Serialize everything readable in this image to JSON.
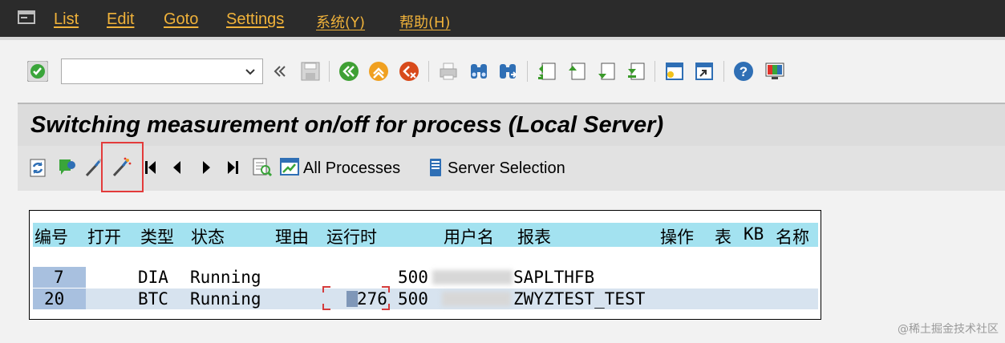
{
  "menu": {
    "items": [
      "List",
      "Edit",
      "Goto",
      "Settings",
      "系统(Y)",
      "帮助(H)"
    ]
  },
  "command_field": {
    "value": ""
  },
  "title": "Switching measurement on/off for process (Local Server)",
  "app_toolbar": {
    "all_processes_label": "All Processes",
    "server_selection_label": "Server Selection"
  },
  "list": {
    "headers": [
      "编号",
      "打开",
      "类型",
      "状态",
      "理由",
      "运行时",
      "用户名",
      "报表",
      "操作",
      "表",
      "KB",
      "名称"
    ],
    "rows": [
      {
        "no": "7",
        "type": "DIA",
        "status": "Running",
        "runtime": "",
        "client": "500",
        "report": "SAPLTHFB"
      },
      {
        "no": "20",
        "type": "BTC",
        "status": "Running",
        "runtime": "276",
        "client": "500",
        "report": "ZWYZTEST_TEST"
      }
    ]
  },
  "watermark": "@稀土掘金技术社区",
  "colors": {
    "menubar": "#2b2b2b",
    "menu_text": "#f0b23a",
    "header_row": "#a3e2f0",
    "key_cell": "#a8c0df",
    "highlight": "#e33b3b"
  }
}
